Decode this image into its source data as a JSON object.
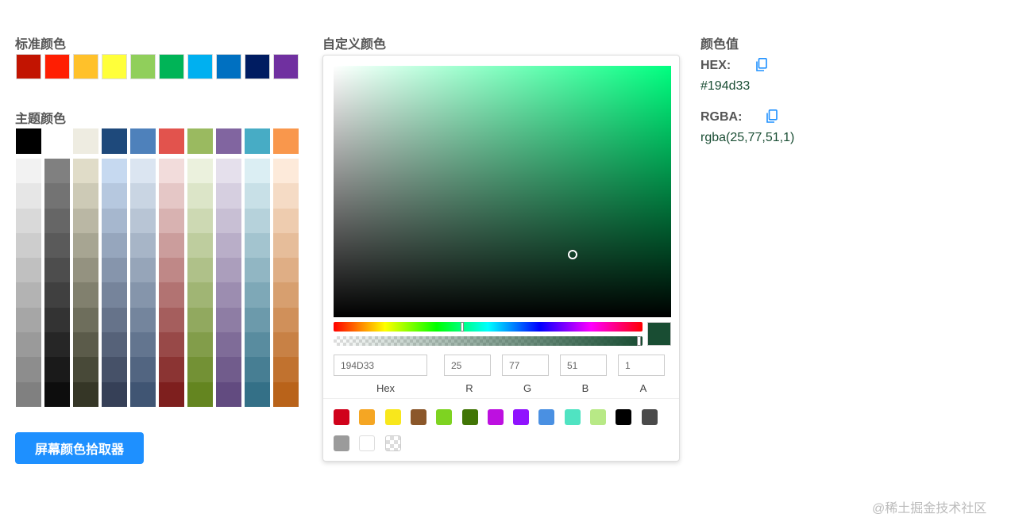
{
  "standard": {
    "title": "标准颜色",
    "colors": [
      "#c21401",
      "#ff1e02",
      "#ffc12a",
      "#ffff3a",
      "#90cf5b",
      "#00b457",
      "#00b0f0",
      "#0070c1",
      "#001c61",
      "#7030a0"
    ]
  },
  "theme": {
    "title": "主题颜色",
    "top": [
      "#000000",
      "#ffffff",
      "#eeece1",
      "#1e497b",
      "#4e81bb",
      "#e2534d",
      "#9aba60",
      "#8165a0",
      "#47acc5",
      "#f9974c"
    ],
    "columns": [
      [
        "#f2f2f2",
        "#e6e6e6",
        "#d9d9d9",
        "#cdcdcd",
        "#c0c0c0",
        "#b3b3b3",
        "#a6a6a6",
        "#9a9a9a",
        "#8d8d8d",
        "#808080"
      ],
      [
        "#808080",
        "#737373",
        "#666666",
        "#5a5a5a",
        "#4d4d4d",
        "#404040",
        "#333333",
        "#262626",
        "#1a1a1a",
        "#0d0d0d"
      ],
      [
        "#e0dcc8",
        "#cdcab6",
        "#bab7a4",
        "#a7a592",
        "#949280",
        "#81806e",
        "#6e6e5c",
        "#5b5b4a",
        "#484938",
        "#353626"
      ],
      [
        "#c6d9f0",
        "#b6c8df",
        "#a6b7ce",
        "#96a6bd",
        "#8695ac",
        "#76849b",
        "#66738a",
        "#566279",
        "#465168",
        "#364057"
      ],
      [
        "#dbe5f1",
        "#c9d5e3",
        "#b8c5d5",
        "#a7b5c7",
        "#96a5b9",
        "#8595ab",
        "#74859d",
        "#63758f",
        "#526581",
        "#405573"
      ],
      [
        "#f2dcdb",
        "#e5c7c6",
        "#d8b2b1",
        "#cb9d9c",
        "#bf8887",
        "#b27372",
        "#a55e5d",
        "#984948",
        "#8b3433",
        "#7e1f1e"
      ],
      [
        "#ebf1dd",
        "#dce5c8",
        "#cdd9b3",
        "#becd9e",
        "#afc189",
        "#a0b574",
        "#91a95f",
        "#829d4a",
        "#739135",
        "#648520"
      ],
      [
        "#e5e0ec",
        "#d6cfe0",
        "#c8bfd4",
        "#b9aec8",
        "#ab9ebc",
        "#9c8db0",
        "#8e7da4",
        "#7f6c98",
        "#715c8c",
        "#624b80"
      ],
      [
        "#dbeef3",
        "#c8e0e7",
        "#b6d2db",
        "#a3c4cf",
        "#91b6c3",
        "#7ea8b7",
        "#6c9aab",
        "#598c9f",
        "#477e93",
        "#347087"
      ],
      [
        "#fdeada",
        "#f5dbc5",
        "#eeccaf",
        "#e6bd9a",
        "#dfae85",
        "#d79f6f",
        "#d0905a",
        "#c88145",
        "#c1722f",
        "#b9631a"
      ]
    ]
  },
  "button": {
    "label": "屏幕颜色拾取器"
  },
  "custom": {
    "title": "自定义颜色",
    "current_color": "#194d33",
    "hue_degrees": 150,
    "alpha": 1,
    "fields": {
      "hex": {
        "value": "194D33",
        "label": "Hex"
      },
      "r": {
        "value": "25",
        "label": "R"
      },
      "g": {
        "value": "77",
        "label": "G"
      },
      "b": {
        "value": "51",
        "label": "B"
      },
      "a": {
        "value": "1",
        "label": "A"
      }
    },
    "presets": [
      "#d0021b",
      "#f5a623",
      "#f8e71c",
      "#8b572a",
      "#7ed321",
      "#417505",
      "#bd10e0",
      "#9013fe",
      "#4a90e2",
      "#50e3c2",
      "#b8e986",
      "#000000",
      "#4a4a4a",
      "#9b9b9b",
      "#ffffff",
      "transparent"
    ]
  },
  "values": {
    "title": "颜色值",
    "hex_label": "HEX:",
    "hex_value": "#194d33",
    "rgba_label": "RGBA:",
    "rgba_value": "rgba(25,77,51,1)"
  },
  "watermark": "@稀土掘金技术社区"
}
